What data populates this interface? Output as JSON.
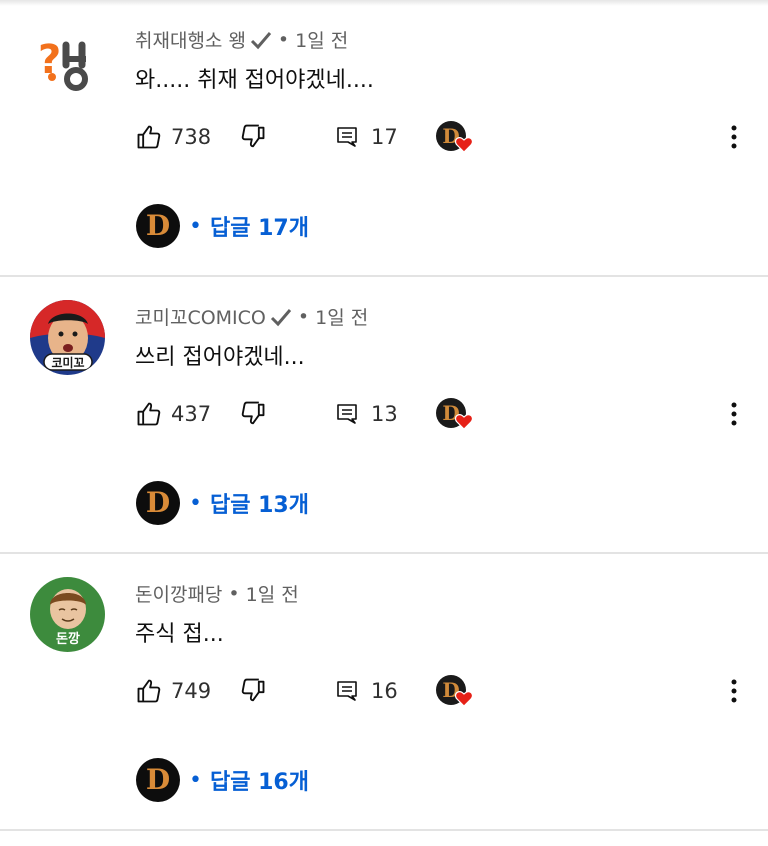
{
  "comments": [
    {
      "author": "취재대행소 왱",
      "verified": true,
      "age": "1일 전",
      "text": "와..... 취재 접어야겠네....",
      "likes": "738",
      "replies_count": "17",
      "replies_label": "답글 17개",
      "avatar": "question-logo-avatar"
    },
    {
      "author": "코미꼬COMICO",
      "verified": true,
      "age": "1일 전",
      "text": "쓰리 접어야겠네...",
      "likes": "437",
      "replies_count": "13",
      "replies_label": "답글 13개",
      "avatar": "comico-cartoon-avatar",
      "avatar_text": "코미꼬"
    },
    {
      "author": "돈이깡패당",
      "verified": false,
      "age": "1일 전",
      "text": "주식 접...",
      "likes": "749",
      "replies_count": "16",
      "replies_label": "답글 16개",
      "avatar": "donkkang-cartoon-avatar",
      "avatar_text": "돈깡"
    }
  ],
  "separator": "•",
  "colors": {
    "link": "#065fd4",
    "meta": "#606060",
    "text": "#0f0f0f",
    "heart": "#e62117",
    "divider": "#e3e3e3"
  },
  "icons": {
    "like": "thumbs-up-icon",
    "dislike": "thumbs-down-icon",
    "reply": "reply-comment-icon",
    "hearted": "creator-heart-icon",
    "more": "more-vert-icon"
  }
}
